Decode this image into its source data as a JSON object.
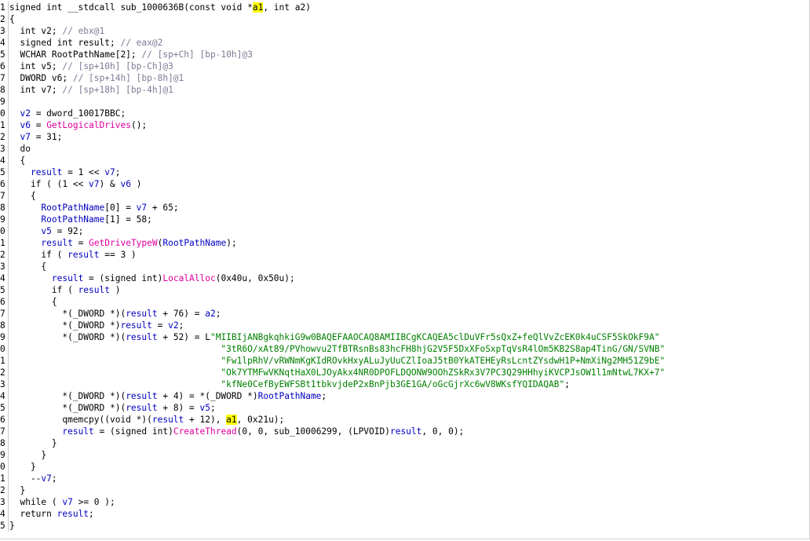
{
  "view": {
    "type": "pseudocode",
    "highlight_color": "#ffff00"
  },
  "colors": {
    "keyword": "#000000",
    "variable": "#0000c0",
    "comment": "#7b7b96",
    "function": "#e000a0",
    "string": "#008000"
  },
  "line_numbers": [
    "1",
    "2",
    "3",
    "4",
    "5",
    "6",
    "7",
    "8",
    "9",
    "0",
    "1",
    "2",
    "3",
    "4",
    "5",
    "6",
    "7",
    "8",
    "9",
    "0",
    "1",
    "2",
    "3",
    "4",
    "5",
    "6",
    "7",
    "8",
    "9",
    "0",
    "1",
    "2",
    "3",
    "4",
    "5",
    "6",
    "7",
    "8",
    "9",
    "0",
    "1",
    "2",
    "3",
    "4",
    "5"
  ],
  "lines": [
    [
      {
        "c": "k",
        "t": "signed int __stdcall sub_1000636B(const void *"
      },
      {
        "c": "hl",
        "t": "a1"
      },
      {
        "c": "k",
        "t": ", int a2)"
      }
    ],
    [
      {
        "c": "k",
        "t": "{"
      }
    ],
    [
      {
        "c": "k",
        "t": "  int v2; "
      },
      {
        "c": "m",
        "t": "// ebx@1"
      }
    ],
    [
      {
        "c": "k",
        "t": "  signed int result; "
      },
      {
        "c": "m",
        "t": "// eax@2"
      }
    ],
    [
      {
        "c": "k",
        "t": "  WCHAR RootPathName[2]; "
      },
      {
        "c": "m",
        "t": "// [sp+Ch] [bp-10h]@3"
      }
    ],
    [
      {
        "c": "k",
        "t": "  int v5; "
      },
      {
        "c": "m",
        "t": "// [sp+10h] [bp-Ch]@3"
      }
    ],
    [
      {
        "c": "k",
        "t": "  DWORD v6; "
      },
      {
        "c": "m",
        "t": "// [sp+14h] [bp-8h]@1"
      }
    ],
    [
      {
        "c": "k",
        "t": "  int v7; "
      },
      {
        "c": "m",
        "t": "// [sp+18h] [bp-4h]@1"
      }
    ],
    [
      {
        "c": "k",
        "t": ""
      }
    ],
    [
      {
        "c": "k",
        "t": "  "
      },
      {
        "c": "v",
        "t": "v2"
      },
      {
        "c": "k",
        "t": " = dword_10017BBC;"
      }
    ],
    [
      {
        "c": "k",
        "t": "  "
      },
      {
        "c": "v",
        "t": "v6"
      },
      {
        "c": "k",
        "t": " = "
      },
      {
        "c": "f",
        "t": "GetLogicalDrives"
      },
      {
        "c": "k",
        "t": "();"
      }
    ],
    [
      {
        "c": "k",
        "t": "  "
      },
      {
        "c": "v",
        "t": "v7"
      },
      {
        "c": "k",
        "t": " = 31;"
      }
    ],
    [
      {
        "c": "k",
        "t": "  do"
      }
    ],
    [
      {
        "c": "k",
        "t": "  {"
      }
    ],
    [
      {
        "c": "k",
        "t": "    "
      },
      {
        "c": "v",
        "t": "result"
      },
      {
        "c": "k",
        "t": " = 1 << "
      },
      {
        "c": "v",
        "t": "v7"
      },
      {
        "c": "k",
        "t": ";"
      }
    ],
    [
      {
        "c": "k",
        "t": "    if ( (1 << "
      },
      {
        "c": "v",
        "t": "v7"
      },
      {
        "c": "k",
        "t": ") & "
      },
      {
        "c": "v",
        "t": "v6"
      },
      {
        "c": "k",
        "t": " )"
      }
    ],
    [
      {
        "c": "k",
        "t": "    {"
      }
    ],
    [
      {
        "c": "k",
        "t": "      "
      },
      {
        "c": "v",
        "t": "RootPathName"
      },
      {
        "c": "k",
        "t": "[0] = "
      },
      {
        "c": "v",
        "t": "v7"
      },
      {
        "c": "k",
        "t": " + 65;"
      }
    ],
    [
      {
        "c": "k",
        "t": "      "
      },
      {
        "c": "v",
        "t": "RootPathName"
      },
      {
        "c": "k",
        "t": "[1] = 58;"
      }
    ],
    [
      {
        "c": "k",
        "t": "      "
      },
      {
        "c": "v",
        "t": "v5"
      },
      {
        "c": "k",
        "t": " = 92;"
      }
    ],
    [
      {
        "c": "k",
        "t": "      "
      },
      {
        "c": "v",
        "t": "result"
      },
      {
        "c": "k",
        "t": " = "
      },
      {
        "c": "f",
        "t": "GetDriveTypeW"
      },
      {
        "c": "k",
        "t": "("
      },
      {
        "c": "v",
        "t": "RootPathName"
      },
      {
        "c": "k",
        "t": ");"
      }
    ],
    [
      {
        "c": "k",
        "t": "      if ( "
      },
      {
        "c": "v",
        "t": "result"
      },
      {
        "c": "k",
        "t": " == 3 )"
      }
    ],
    [
      {
        "c": "k",
        "t": "      {"
      }
    ],
    [
      {
        "c": "k",
        "t": "        "
      },
      {
        "c": "v",
        "t": "result"
      },
      {
        "c": "k",
        "t": " = (signed int)"
      },
      {
        "c": "f",
        "t": "LocalAlloc"
      },
      {
        "c": "k",
        "t": "(0x40u, 0x50u);"
      }
    ],
    [
      {
        "c": "k",
        "t": "        if ( "
      },
      {
        "c": "v",
        "t": "result"
      },
      {
        "c": "k",
        "t": " )"
      }
    ],
    [
      {
        "c": "k",
        "t": "        {"
      }
    ],
    [
      {
        "c": "k",
        "t": "          *(_DWORD *)("
      },
      {
        "c": "v",
        "t": "result"
      },
      {
        "c": "k",
        "t": " + 76) = "
      },
      {
        "c": "v",
        "t": "a2"
      },
      {
        "c": "k",
        "t": ";"
      }
    ],
    [
      {
        "c": "k",
        "t": "          *(_DWORD *)"
      },
      {
        "c": "v",
        "t": "result"
      },
      {
        "c": "k",
        "t": " = "
      },
      {
        "c": "v",
        "t": "v2"
      },
      {
        "c": "k",
        "t": ";"
      }
    ],
    [
      {
        "c": "k",
        "t": "          *(_DWORD *)("
      },
      {
        "c": "v",
        "t": "result"
      },
      {
        "c": "k",
        "t": " + 52) = L"
      },
      {
        "c": "s",
        "t": "\"MIIBIjANBgkqhkiG9w0BAQEFAAOCAQ8AMIIBCgKCAQEA5clDuVFr5sQxZ+feQlVvZcEK0k4uCSF5SkOkF9A\""
      }
    ],
    [
      {
        "c": "k",
        "t": "                                        "
      },
      {
        "c": "s",
        "t": "\"3tR6O/xAt89/PVhowvu2TfBTRsnBs83hcFH8hjG2V5F5DxXFoSxpTqVsR4lOm5KB2S8ap4TinG/GN/SVNB\""
      }
    ],
    [
      {
        "c": "k",
        "t": "                                        "
      },
      {
        "c": "s",
        "t": "\"Fw1lpRhV/vRWNmKgKIdROvkHxyALuJyUuCZlIoaJ5tB0YkATEHEyRsLcntZYsdwH1P+NmXiNg2MH51Z9bE\""
      }
    ],
    [
      {
        "c": "k",
        "t": "                                        "
      },
      {
        "c": "s",
        "t": "\"Ok7YTMFwVKNqtHaX0LJOyAkx4NR0DPOFLDQONW9OOhZSkRx3V7PC3Q29HHhyiKVCPJsOW1l1mNtwL7KX+7\""
      }
    ],
    [
      {
        "c": "k",
        "t": "                                        "
      },
      {
        "c": "s",
        "t": "\"kfNe0CefByEWFSBt1tbkvjdeP2xBnPjb3GE1GA/oGcGjrXc6wV8WKsfYQIDAQAB\""
      },
      {
        "c": "k",
        "t": ";"
      }
    ],
    [
      {
        "c": "k",
        "t": "          *(_DWORD *)("
      },
      {
        "c": "v",
        "t": "result"
      },
      {
        "c": "k",
        "t": " + 4) = *(_DWORD *)"
      },
      {
        "c": "v",
        "t": "RootPathName"
      },
      {
        "c": "k",
        "t": ";"
      }
    ],
    [
      {
        "c": "k",
        "t": "          *(_DWORD *)("
      },
      {
        "c": "v",
        "t": "result"
      },
      {
        "c": "k",
        "t": " + 8) = "
      },
      {
        "c": "v",
        "t": "v5"
      },
      {
        "c": "k",
        "t": ";"
      }
    ],
    [
      {
        "c": "k",
        "t": "          qmemcpy((void *)("
      },
      {
        "c": "v",
        "t": "result"
      },
      {
        "c": "k",
        "t": " + 12), "
      },
      {
        "c": "hl",
        "t": "a1"
      },
      {
        "c": "k",
        "t": ", 0x21u);"
      }
    ],
    [
      {
        "c": "k",
        "t": "          "
      },
      {
        "c": "v",
        "t": "result"
      },
      {
        "c": "k",
        "t": " = (signed int)"
      },
      {
        "c": "f",
        "t": "CreateThread"
      },
      {
        "c": "k",
        "t": "(0, 0, sub_10006299, (LPVOID)"
      },
      {
        "c": "v",
        "t": "result"
      },
      {
        "c": "k",
        "t": ", 0, 0);"
      }
    ],
    [
      {
        "c": "k",
        "t": "        }"
      }
    ],
    [
      {
        "c": "k",
        "t": "      }"
      }
    ],
    [
      {
        "c": "k",
        "t": "    }"
      }
    ],
    [
      {
        "c": "k",
        "t": "    --"
      },
      {
        "c": "v",
        "t": "v7"
      },
      {
        "c": "k",
        "t": ";"
      }
    ],
    [
      {
        "c": "k",
        "t": "  }"
      }
    ],
    [
      {
        "c": "k",
        "t": "  while ( "
      },
      {
        "c": "v",
        "t": "v7"
      },
      {
        "c": "k",
        "t": " >= 0 );"
      }
    ],
    [
      {
        "c": "k",
        "t": "  return "
      },
      {
        "c": "v",
        "t": "result"
      },
      {
        "c": "k",
        "t": ";"
      }
    ],
    [
      {
        "c": "k",
        "t": "}"
      }
    ]
  ]
}
